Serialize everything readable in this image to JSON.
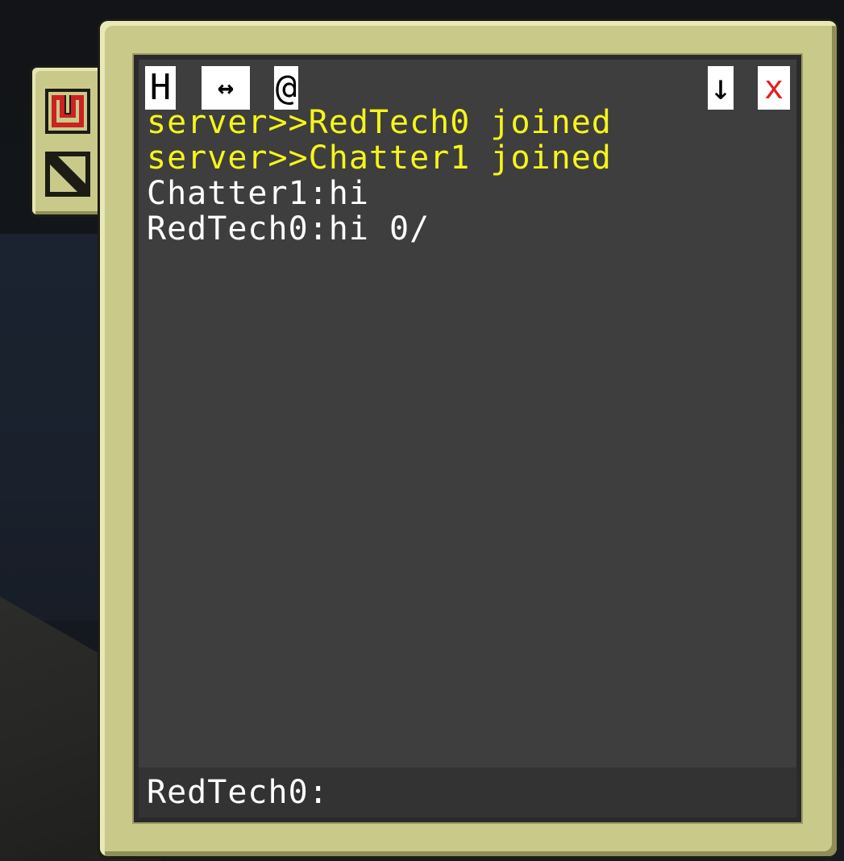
{
  "toolbar": {
    "history_label": "H",
    "swap_label": "↔",
    "mention_label": "@",
    "scroll_down_label": "↓",
    "close_label": "x"
  },
  "messages": [
    {
      "kind": "server",
      "text": "server>>RedTech0 joined"
    },
    {
      "kind": "server",
      "text": "server>>Chatter1 joined"
    },
    {
      "kind": "user",
      "text": "Chatter1:hi"
    },
    {
      "kind": "user",
      "text": "RedTech0:hi 0/"
    }
  ],
  "input": {
    "prompt": "RedTech0:",
    "value": ""
  },
  "side_tabs": [
    {
      "icon": "power-icon",
      "color": "#cc2222"
    },
    {
      "icon": "no-entry-icon",
      "color": "#1c1c14"
    }
  ],
  "colors": {
    "frame": "#c9c98a",
    "screen": "#3e3e3e",
    "server_text": "#f5f51a",
    "user_text": "#ffffff"
  }
}
